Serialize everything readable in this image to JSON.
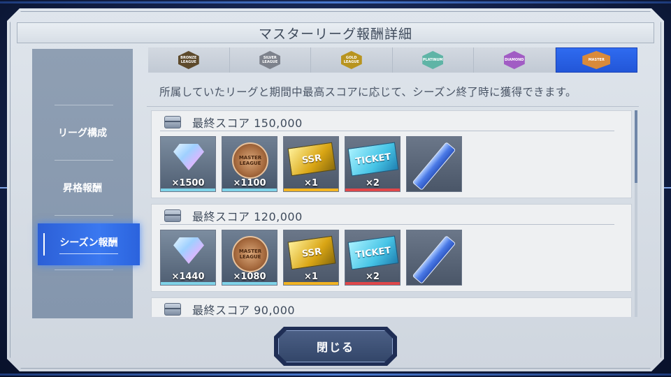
{
  "title": "マスターリーグ報酬詳細",
  "description": "所属していたリーグと期間中最高スコアに応じて、シーズン終了時に獲得できます。",
  "sidebar": {
    "items": [
      {
        "label": "リーグ構成",
        "active": false
      },
      {
        "label": "昇格報酬",
        "active": false
      },
      {
        "label": "シーズン報酬",
        "active": true
      }
    ]
  },
  "league_tabs": [
    {
      "name": "bronze",
      "badge_text": "BRONZE LEAGUE",
      "color": "#6b5a3a",
      "active": false
    },
    {
      "name": "silver",
      "badge_text": "SILVER LEAGUE",
      "color": "#8a8f98",
      "active": false
    },
    {
      "name": "gold",
      "badge_text": "GOLD LEAGUE",
      "color": "#c9a227",
      "active": false
    },
    {
      "name": "platinum",
      "badge_text": "PLATINUM",
      "color": "#6fc6b6",
      "active": false
    },
    {
      "name": "diamond",
      "badge_text": "DIAMOND",
      "color": "#b36ad6",
      "active": false
    },
    {
      "name": "master",
      "badge_text": "MASTER",
      "color": "#d98a3a",
      "active": true
    }
  ],
  "score_blocks": [
    {
      "label": "最終スコア 150,000",
      "items": [
        {
          "type": "gem",
          "qty": "×1500"
        },
        {
          "type": "medal",
          "qty": "×1100",
          "art_text": "MASTER LEAGUE"
        },
        {
          "type": "ssr",
          "qty": "×1",
          "art_text": "SSR"
        },
        {
          "type": "ticket",
          "qty": "×2",
          "art_text": "TICKET"
        },
        {
          "type": "item",
          "qty": ""
        }
      ]
    },
    {
      "label": "最終スコア 120,000",
      "items": [
        {
          "type": "gem",
          "qty": "×1440"
        },
        {
          "type": "medal",
          "qty": "×1080",
          "art_text": "MASTER LEAGUE"
        },
        {
          "type": "ssr",
          "qty": "×1",
          "art_text": "SSR"
        },
        {
          "type": "ticket",
          "qty": "×2",
          "art_text": "TICKET"
        },
        {
          "type": "item",
          "qty": ""
        }
      ]
    },
    {
      "label": "最終スコア 90,000",
      "items": []
    }
  ],
  "close_button": "閉じる"
}
